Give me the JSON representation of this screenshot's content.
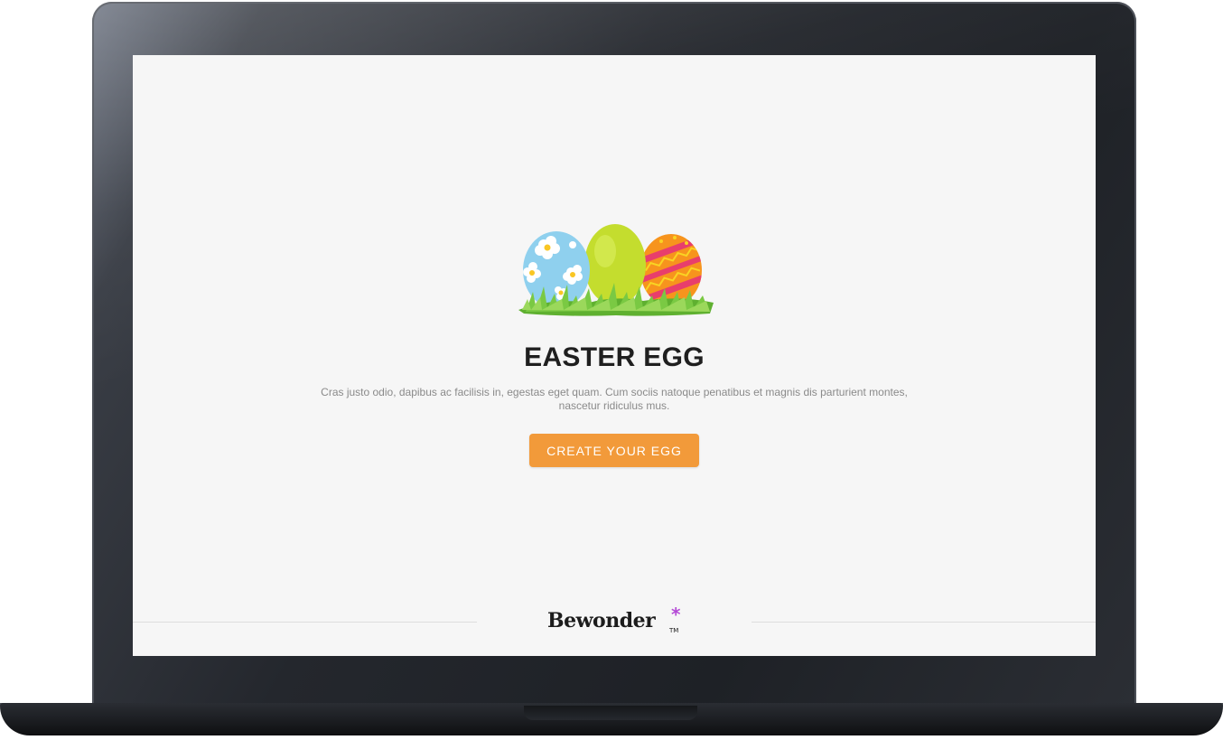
{
  "hero": {
    "title": "EASTER EGG",
    "description": "Cras justo odio, dapibus ac facilisis in, egestas eget quam. Cum sociis natoque penatibus et magnis dis parturient montes, nascetur ridiculus mus.",
    "cta_label": "CREATE YOUR EGG",
    "illustration_icon": "easter-eggs-in-grass-illustration"
  },
  "footer": {
    "brand_name": "Bewonder",
    "brand_mark": "*",
    "trademark": "TM"
  },
  "colors": {
    "page_background": "#f6f6f6",
    "cta_background": "#f29a3a",
    "cta_text": "#ffffff",
    "title_text": "#1f1f1f",
    "description_text": "#8a8a8a",
    "brand_accent": "#b44ad6",
    "device_frame": "#24272d"
  }
}
